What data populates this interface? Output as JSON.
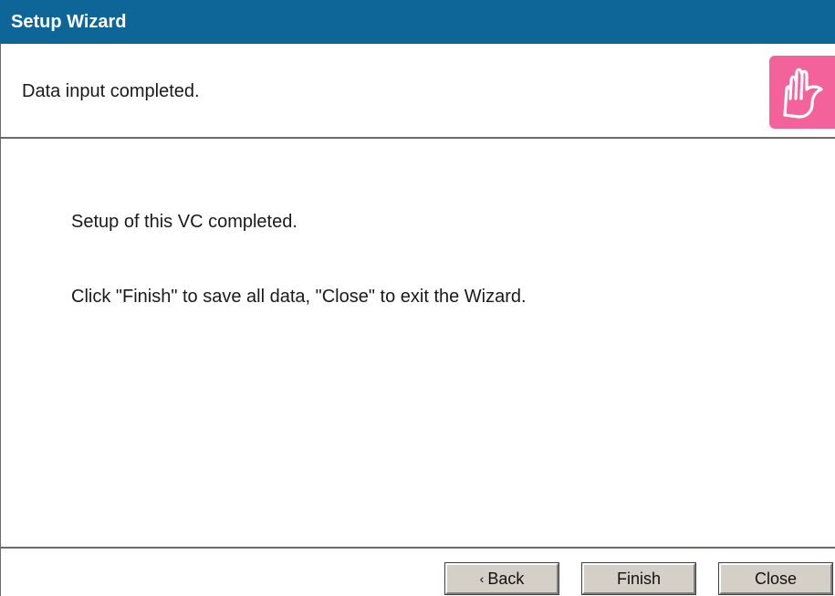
{
  "window": {
    "title": "Setup Wizard"
  },
  "header": {
    "text": "Data input completed.",
    "icon": "hand-icon",
    "icon_color": "#f4629c"
  },
  "content": {
    "line1": "Setup of this VC completed.",
    "line2": "Click \"Finish\" to save all data, \"Close\" to exit the Wizard."
  },
  "buttons": {
    "back_label": "Back",
    "finish_label": "Finish",
    "close_label": "Close"
  },
  "colors": {
    "title_bar": "#0e6597",
    "button_face": "#d4d0c8"
  }
}
